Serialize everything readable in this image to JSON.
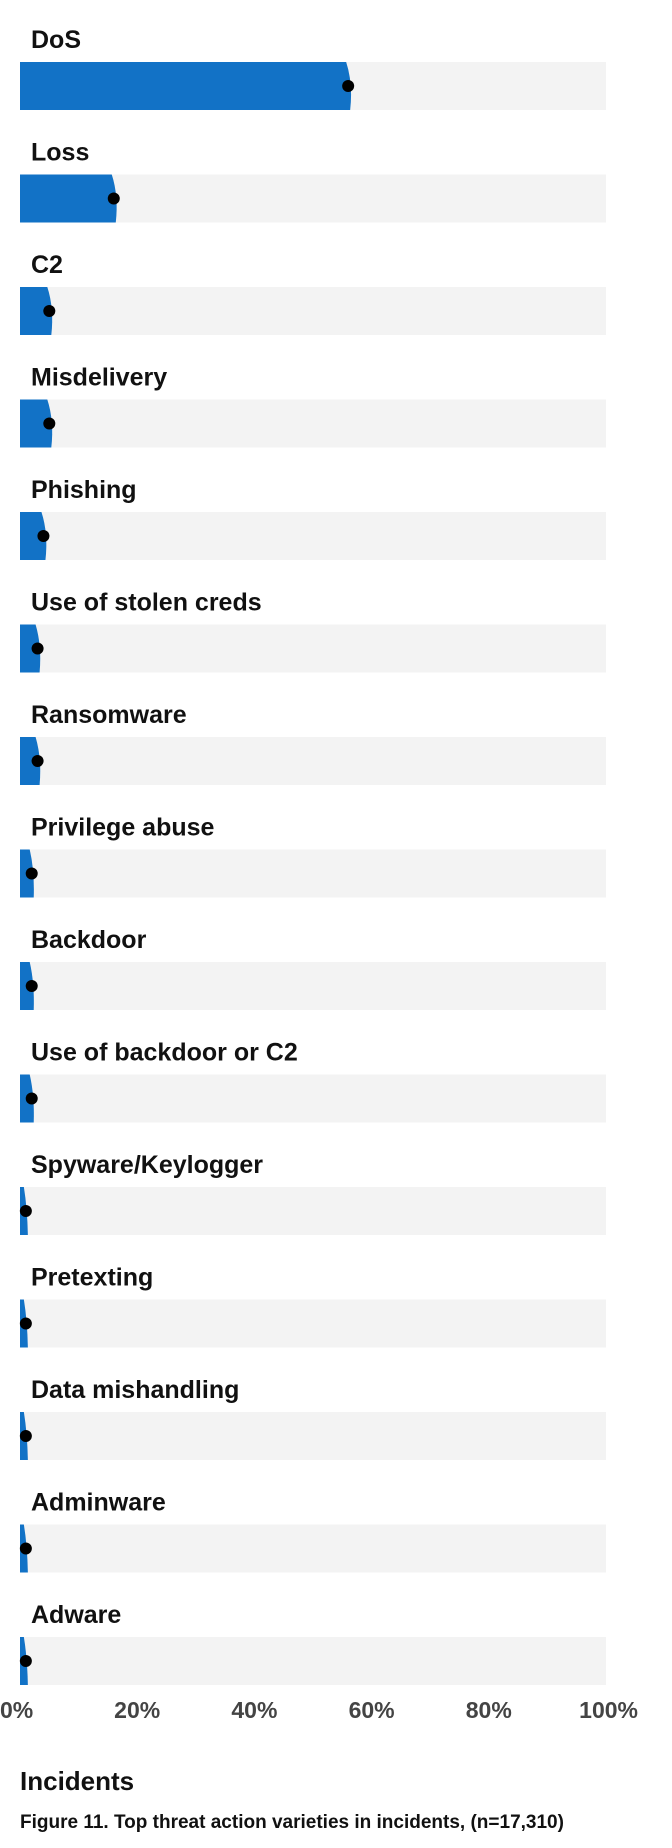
{
  "chart_data": {
    "type": "bar",
    "orientation": "horizontal",
    "categories": [
      "DoS",
      "Loss",
      "C2",
      "Misdelivery",
      "Phishing",
      "Use of stolen creds",
      "Ransomware",
      "Privilege abuse",
      "Backdoor",
      "Use of backdoor or C2",
      "Spyware/Keylogger",
      "Pretexting",
      "Data mishandling",
      "Adminware",
      "Adware"
    ],
    "values": [
      56,
      16,
      5,
      5,
      4,
      3,
      3,
      2,
      2,
      2,
      1,
      1,
      1,
      1,
      1
    ],
    "value_unit": "%",
    "xlim": [
      0,
      100
    ],
    "ticks": [
      "0%",
      "20%",
      "40%",
      "60%",
      "80%",
      "100%"
    ],
    "tick_values": [
      0,
      20,
      40,
      60,
      80,
      100
    ],
    "xlabel": "Incidents",
    "caption": "Figure 11. Top threat action varieties in incidents, (n=17,310)",
    "grid": false,
    "legend": "none",
    "colors": {
      "bar": "#1272c6",
      "track": "#f3f3f3",
      "marker": "#000000"
    }
  }
}
